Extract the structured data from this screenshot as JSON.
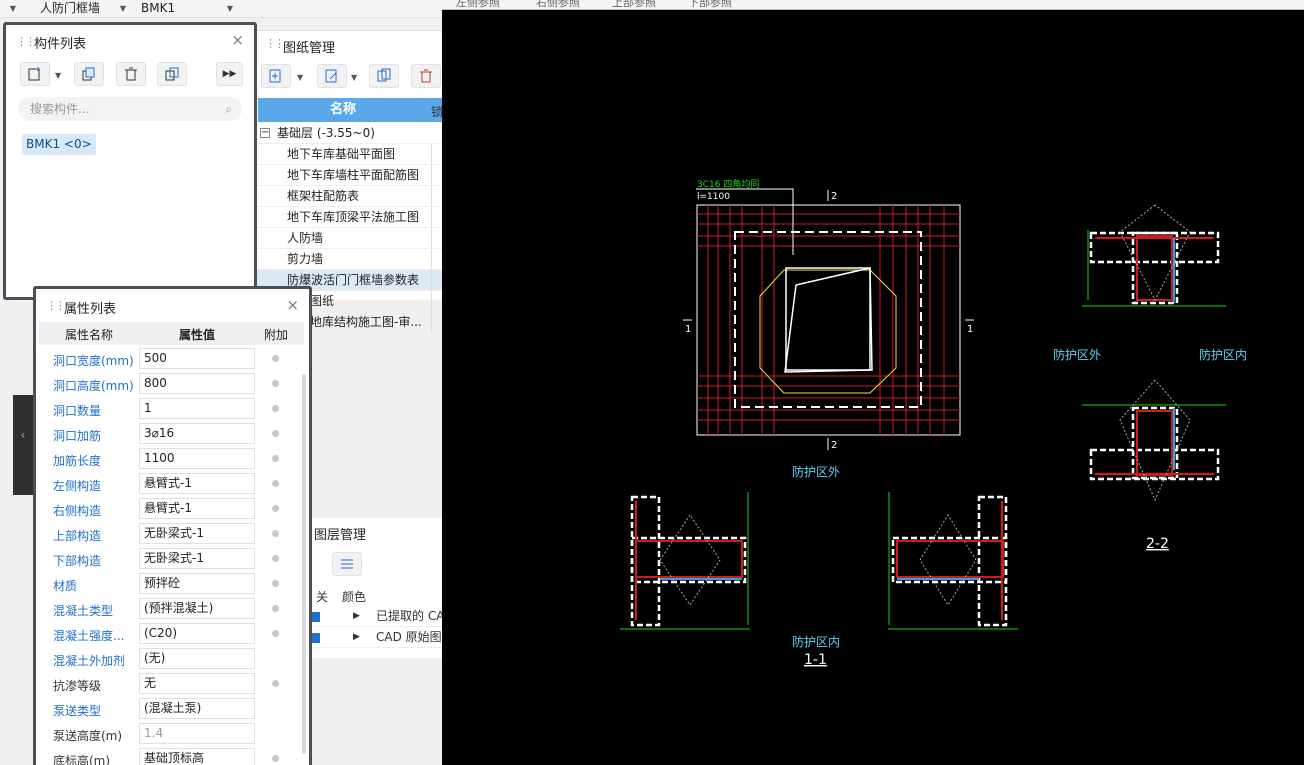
{
  "top": {
    "component_type": "人防门框墙",
    "component_name": "BMK1"
  },
  "cad_tabs": [
    "左侧参照",
    "右侧参照",
    "上部参照",
    "下部参照"
  ],
  "component_panel": {
    "title": "构件列表",
    "search_placeholder": "搜索构件...",
    "items": [
      {
        "label": "BMK1 <0>"
      }
    ]
  },
  "drawing_panel": {
    "title": "图纸管理",
    "column_name": "名称",
    "column_lock": "锁",
    "group": "基础层 (-3.55~0)",
    "rows": [
      "地下车库基础平面图",
      "地下车库墙柱平面配筋图",
      "框架柱配筋表",
      "地下车库顶梁平法施工图",
      "人防墙",
      "剪力墙",
      "防爆波活门门框墙参数表",
      "图纸",
      "地库结构施工图-审..."
    ]
  },
  "layer_panel": {
    "title": "图层管理",
    "col_switch": "关",
    "col_color": "颜色",
    "rows": [
      "已提取的 CA",
      "CAD 原始图"
    ]
  },
  "property_panel": {
    "title": "属性列表",
    "headers": {
      "name": "属性名称",
      "value": "属性值",
      "extra": "附加"
    },
    "rows": [
      {
        "name": "洞口宽度(mm)",
        "value": "500",
        "link": true,
        "extra": true
      },
      {
        "name": "洞口高度(mm)",
        "value": "800",
        "link": true,
        "extra": true
      },
      {
        "name": "洞口数量",
        "value": "1",
        "link": true,
        "extra": true
      },
      {
        "name": "洞口加筋",
        "value": "3⌀16",
        "link": true,
        "extra": true
      },
      {
        "name": "加筋长度",
        "value": "1100",
        "link": true,
        "extra": true
      },
      {
        "name": "左侧构造",
        "value": "悬臂式-1",
        "link": true,
        "extra": true
      },
      {
        "name": "右侧构造",
        "value": "悬臂式-1",
        "link": true,
        "extra": true
      },
      {
        "name": "上部构造",
        "value": "无卧梁式-1",
        "link": true,
        "extra": true
      },
      {
        "name": "下部构造",
        "value": "无卧梁式-1",
        "link": true,
        "extra": true
      },
      {
        "name": "材质",
        "value": "预拌砼",
        "link": true,
        "extra": true
      },
      {
        "name": "混凝土类型",
        "value": "(预拌混凝土)",
        "link": true,
        "extra": true
      },
      {
        "name": "混凝土强度...",
        "value": "(C20)",
        "link": true,
        "extra": true
      },
      {
        "name": "混凝土外加剂",
        "value": "(无)",
        "link": true,
        "extra": false
      },
      {
        "name": "抗渗等级",
        "value": "无",
        "link": false,
        "extra": true
      },
      {
        "name": "泵送类型",
        "value": "(混凝土泵)",
        "link": true,
        "extra": false
      },
      {
        "name": "泵送高度(m)",
        "value": "1.4",
        "link": false,
        "extra": false,
        "grey": true
      },
      {
        "name": "底标高(m)",
        "value": "基础顶标高",
        "link": false,
        "extra": true
      }
    ]
  },
  "cad": {
    "note_line1": "3C16 四角均同",
    "note_line2": "l=1100",
    "label_outside": "防护区外",
    "label_inside": "防护区内",
    "section_11": "1-1",
    "section_22": "2-2",
    "mark_2": "2",
    "mark_1": "1",
    "colors": {
      "red": "#e0201b",
      "white": "#ffffff",
      "yellow": "#f0e040",
      "cyan": "#5fd3f3",
      "green": "#16d616"
    }
  }
}
